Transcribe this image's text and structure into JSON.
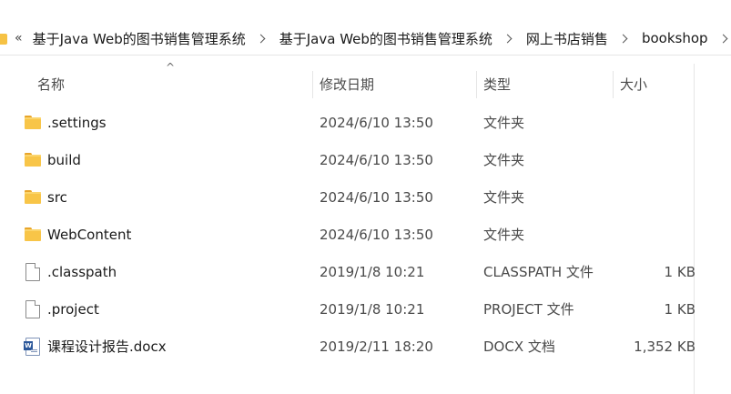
{
  "breadcrumb": {
    "overflow": "«",
    "items": [
      "基于Java Web的图书销售管理系统",
      "基于Java Web的图书销售管理系统",
      "网上书店销售",
      "bookshop"
    ]
  },
  "columns": {
    "name": "名称",
    "date": "修改日期",
    "type": "类型",
    "size": "大小"
  },
  "files": [
    {
      "name": ".settings",
      "date": "2024/6/10 13:50",
      "type": "文件夹",
      "size": "",
      "icon": "folder-icon"
    },
    {
      "name": "build",
      "date": "2024/6/10 13:50",
      "type": "文件夹",
      "size": "",
      "icon": "folder-icon"
    },
    {
      "name": "src",
      "date": "2024/6/10 13:50",
      "type": "文件夹",
      "size": "",
      "icon": "folder-icon"
    },
    {
      "name": "WebContent",
      "date": "2024/6/10 13:50",
      "type": "文件夹",
      "size": "",
      "icon": "folder-icon"
    },
    {
      "name": ".classpath",
      "date": "2019/1/8 10:21",
      "type": "CLASSPATH 文件",
      "size": "1 KB",
      "icon": "file-icon"
    },
    {
      "name": ".project",
      "date": "2019/1/8 10:21",
      "type": "PROJECT 文件",
      "size": "1 KB",
      "icon": "file-icon"
    },
    {
      "name": "课程设计报告.docx",
      "date": "2019/2/11 18:20",
      "type": "DOCX 文档",
      "size": "1,352 KB",
      "icon": "word-document-icon"
    }
  ]
}
